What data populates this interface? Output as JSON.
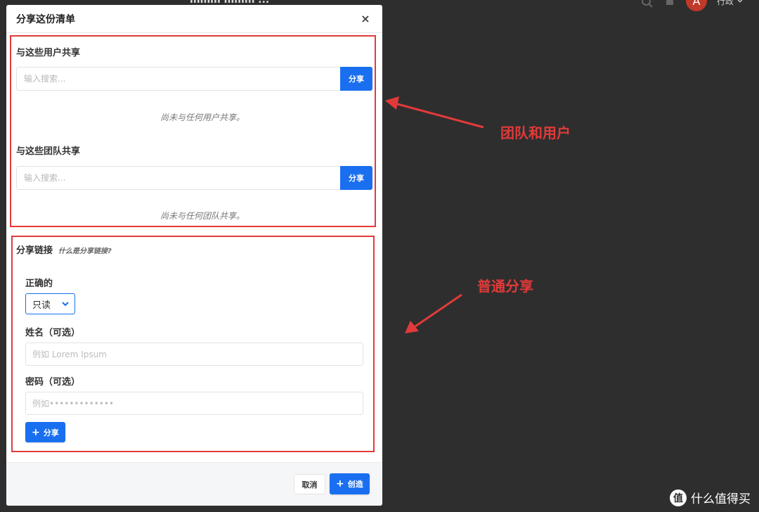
{
  "background": {
    "title": "mmm mmm  ...",
    "avatar_letter": "A",
    "user_name": "行政"
  },
  "modal": {
    "title": "分享这份清单",
    "close_symbol": "×",
    "users_section": {
      "title": "与这些用户共享",
      "search_placeholder": "输入搜索...",
      "share_label": "分享",
      "empty_message": "尚未与任何用户共享。"
    },
    "teams_section": {
      "title": "与这些团队共享",
      "search_placeholder": "输入搜索...",
      "share_label": "分享",
      "empty_message": "尚未与任何团队共享。"
    },
    "link_section": {
      "title": "分享链接",
      "help_link": "什么是分享链接?",
      "permission_label": "正确的",
      "permission_value": "只读",
      "name_label": "姓名（可选）",
      "name_placeholder": "例如 Lorem Ipsum",
      "password_label": "密码（可选）",
      "password_placeholder": "例如•••••••••••••",
      "add_share_label": "分享"
    },
    "footer": {
      "cancel_label": "取消",
      "create_label": "创造"
    }
  },
  "annotations": {
    "teams_users": "团队和用户",
    "normal_share": "普通分享",
    "color": "#e23a3a"
  },
  "watermark": {
    "logo_text": "值",
    "text": "什么值得买"
  },
  "colors": {
    "primary": "#1a6ff0",
    "backdrop": "#2e2e2e"
  }
}
